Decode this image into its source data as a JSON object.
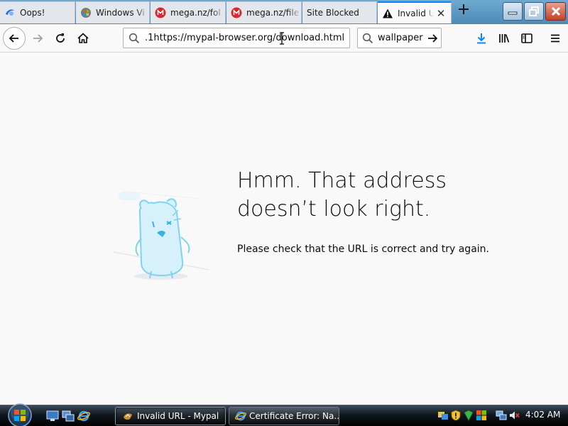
{
  "tabs": [
    {
      "label": "Oops!",
      "icon": "browser-globe-icon"
    },
    {
      "label": "Windows Vi",
      "icon": "windows-globe-icon"
    },
    {
      "label": "mega.nz/fol",
      "icon": "mega-icon"
    },
    {
      "label": "mega.nz/file",
      "icon": "mega-icon"
    },
    {
      "label": "Site Blocked",
      "icon": ""
    },
    {
      "label": "Invalid U",
      "icon": "warning-icon",
      "active": true
    }
  ],
  "window": {
    "minimize": "minimize-icon",
    "maximize": "restore-icon",
    "close": "close-icon"
  },
  "navbar": {
    "url": ".1https://mypal-browser.org/download.html",
    "search_value": "wallpaper"
  },
  "error_page": {
    "title": "Hmm. That address doesn’t look right.",
    "description": "Please check that the URL is correct and try again."
  },
  "taskbar": {
    "buttons": [
      {
        "label": "Invalid URL - Mypal",
        "active": true
      },
      {
        "label": "Certificate Error: Na...",
        "active": false
      }
    ],
    "clock": "4:02 AM"
  },
  "colors": {
    "accent": "#0a84ff",
    "download": "#0a84ff"
  }
}
